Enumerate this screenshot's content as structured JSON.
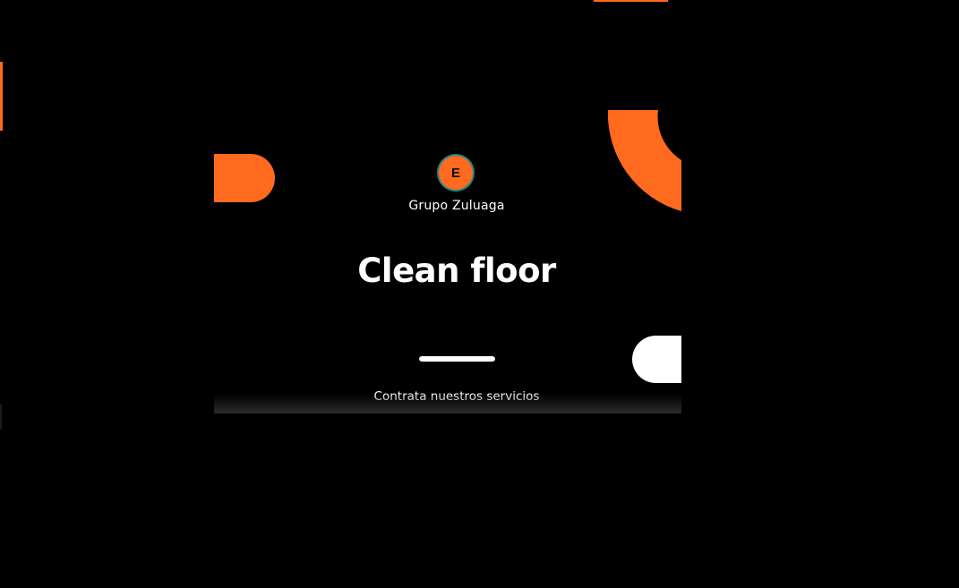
{
  "splash": {
    "logo_letter": "E",
    "brand_name": "Grupo Zuluaga",
    "title": "Clean floor",
    "loading_progress": 1.0,
    "cta_text": "Contrata nuestros servicios"
  },
  "colors": {
    "background": "#000000",
    "accent": "#ff6a1e",
    "text": "#ffffff",
    "logo_ring": "#1f8a8a"
  },
  "icons": {
    "left_shape": "orange-half-pill",
    "right_top_shape": "orange-quarter-ring",
    "right_shape": "white-half-pill"
  }
}
